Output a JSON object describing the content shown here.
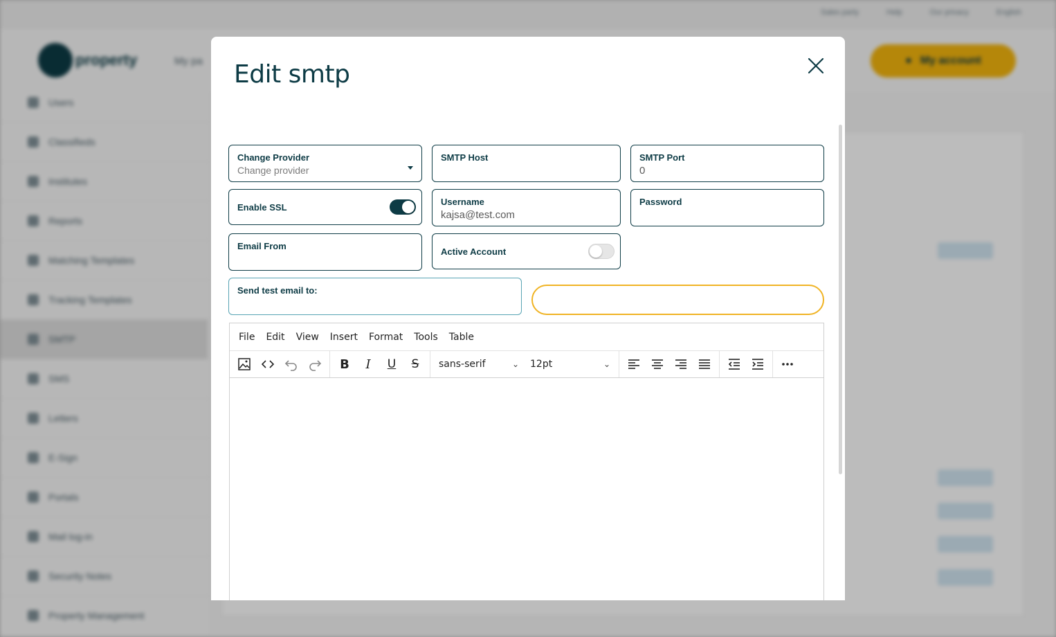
{
  "background": {
    "top_links": [
      "Sales party",
      "Help",
      "Our privacy",
      "English"
    ],
    "brand": "property",
    "nav_partial": "My pa",
    "account_button": "My account",
    "sidebar_items": [
      "Users",
      "Classifieds",
      "Institutes",
      "Reports",
      "Matching Templates",
      "Tracking Templates",
      "SMTP",
      "SMS",
      "Letters",
      "E-Sign",
      "Portals",
      "Mail log-in",
      "Security Notes",
      "Property Management"
    ]
  },
  "modal": {
    "title": "Edit smtp",
    "close_icon": "close-icon"
  },
  "form": {
    "provider": {
      "label": "Change Provider",
      "placeholder": "Change provider"
    },
    "smtp_host": {
      "label": "SMTP Host",
      "value": ""
    },
    "smtp_port": {
      "label": "SMTP Port",
      "value": "0"
    },
    "enable_ssl": {
      "label": "Enable SSL",
      "on": true
    },
    "username": {
      "label": "Username",
      "value": "kajsa@test.com"
    },
    "password": {
      "label": "Password",
      "value": ""
    },
    "email_from": {
      "label": "Email From",
      "value": ""
    },
    "active_account": {
      "label": "Active Account",
      "on": false
    },
    "test_email": {
      "label": "Send test email to:"
    },
    "send_button_label": ""
  },
  "editor": {
    "menu": [
      "File",
      "Edit",
      "View",
      "Insert",
      "Format",
      "Tools",
      "Table"
    ],
    "font_family": "sans-serif",
    "font_size": "12pt",
    "toolbar_icons": [
      "image-icon",
      "code-icon",
      "undo-icon",
      "redo-icon",
      "bold-icon",
      "italic-icon",
      "underline-icon",
      "strikethrough-icon",
      "align-left-icon",
      "align-center-icon",
      "align-right-icon",
      "align-justify-icon",
      "outdent-icon",
      "indent-icon",
      "more-icon"
    ]
  },
  "colors": {
    "primary": "#0d3b45",
    "accent": "#f0b323",
    "focus_border": "#56a3b3"
  }
}
